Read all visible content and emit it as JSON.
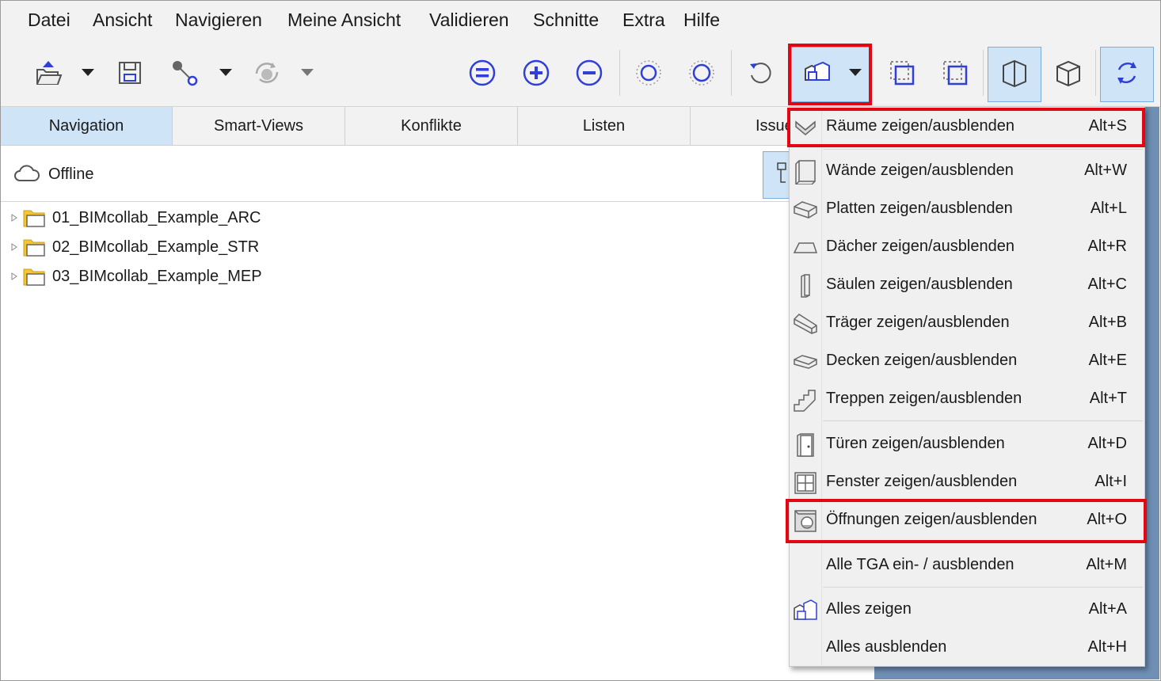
{
  "menubar": [
    "Datei",
    "Ansicht",
    "Navigieren",
    "Meine Ansicht",
    "Validieren",
    "Schnitte",
    "Extra",
    "Hilfe"
  ],
  "toolbar": {
    "icons": [
      "open-icon",
      "save-icon",
      "connect-icon",
      "sync-icon",
      "fit-icon",
      "zoom-in-icon",
      "zoom-out-icon",
      "select-icon",
      "isolate-icon",
      "reset-view-icon",
      "show-types-icon",
      "section-box-icon",
      "section-crop-icon",
      "wireframe-icon",
      "solid-icon",
      "orbit-icon"
    ],
    "accent": "#2f3fd8"
  },
  "tabs": [
    "Navigation",
    "Smart-Views",
    "Konflikte",
    "Listen",
    "Issue"
  ],
  "status": {
    "label": "Offline"
  },
  "tree": [
    {
      "label": "01_BIMcollab_Example_ARC"
    },
    {
      "label": "02_BIMcollab_Example_STR"
    },
    {
      "label": "03_BIMcollab_Example_MEP"
    }
  ],
  "menu": {
    "items": [
      {
        "label": "Räume zeigen/ausblenden",
        "shortcut": "Alt+S",
        "icon": "spaces-icon"
      },
      {
        "label": "Wände zeigen/ausblenden",
        "shortcut": "Alt+W",
        "icon": "walls-icon"
      },
      {
        "label": "Platten zeigen/ausblenden",
        "shortcut": "Alt+L",
        "icon": "slabs-icon"
      },
      {
        "label": "Dächer zeigen/ausblenden",
        "shortcut": "Alt+R",
        "icon": "roofs-icon"
      },
      {
        "label": "Säulen zeigen/ausblenden",
        "shortcut": "Alt+C",
        "icon": "columns-icon"
      },
      {
        "label": "Träger zeigen/ausblenden",
        "shortcut": "Alt+B",
        "icon": "beams-icon"
      },
      {
        "label": "Decken zeigen/ausblenden",
        "shortcut": "Alt+E",
        "icon": "ceilings-icon"
      },
      {
        "label": "Treppen zeigen/ausblenden",
        "shortcut": "Alt+T",
        "icon": "stairs-icon"
      },
      {
        "label": "Türen zeigen/ausblenden",
        "shortcut": "Alt+D",
        "icon": "doors-icon"
      },
      {
        "label": "Fenster zeigen/ausblenden",
        "shortcut": "Alt+I",
        "icon": "windows-icon"
      },
      {
        "label": "Öffnungen zeigen/ausblenden",
        "shortcut": "Alt+O",
        "icon": "openings-icon"
      },
      {
        "label": "Alle TGA ein- / ausblenden",
        "shortcut": "Alt+M",
        "icon": ""
      },
      {
        "label": "Alles zeigen",
        "shortcut": "Alt+A",
        "icon": "show-all-icon"
      },
      {
        "label": "Alles ausblenden",
        "shortcut": "Alt+H",
        "icon": ""
      }
    ]
  },
  "highlight_color": "#e30613"
}
